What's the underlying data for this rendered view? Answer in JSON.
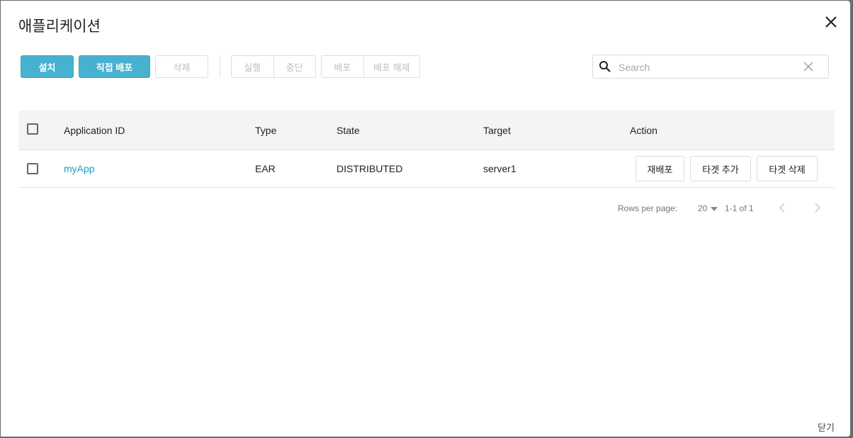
{
  "dialog": {
    "title": "애플리케이션",
    "close_icon": "close-icon",
    "footer_close_label": "닫기"
  },
  "toolbar": {
    "install_label": "설치",
    "direct_deploy_label": "직접 배포",
    "delete_label": "삭제",
    "run_label": "실행",
    "stop_label": "중단",
    "deploy_label": "배포",
    "undeploy_label": "배포 해제"
  },
  "search": {
    "placeholder": "Search",
    "value": "",
    "icon": "search-icon",
    "clear_icon": "clear-icon"
  },
  "table": {
    "columns": [
      "Application ID",
      "Type",
      "State",
      "Target",
      "Action"
    ],
    "rows": [
      {
        "application_id": "myApp",
        "type": "EAR",
        "state": "DISTRIBUTED",
        "target": "server1",
        "actions": [
          "재배포",
          "타겟 추가",
          "타겟 삭제"
        ]
      }
    ]
  },
  "pagination": {
    "rows_per_page_label": "Rows per page:",
    "rows_per_page": "20",
    "range": "1-1 of 1"
  },
  "colors": {
    "primary": "#47b2cf",
    "link": "#1a9dbd"
  }
}
